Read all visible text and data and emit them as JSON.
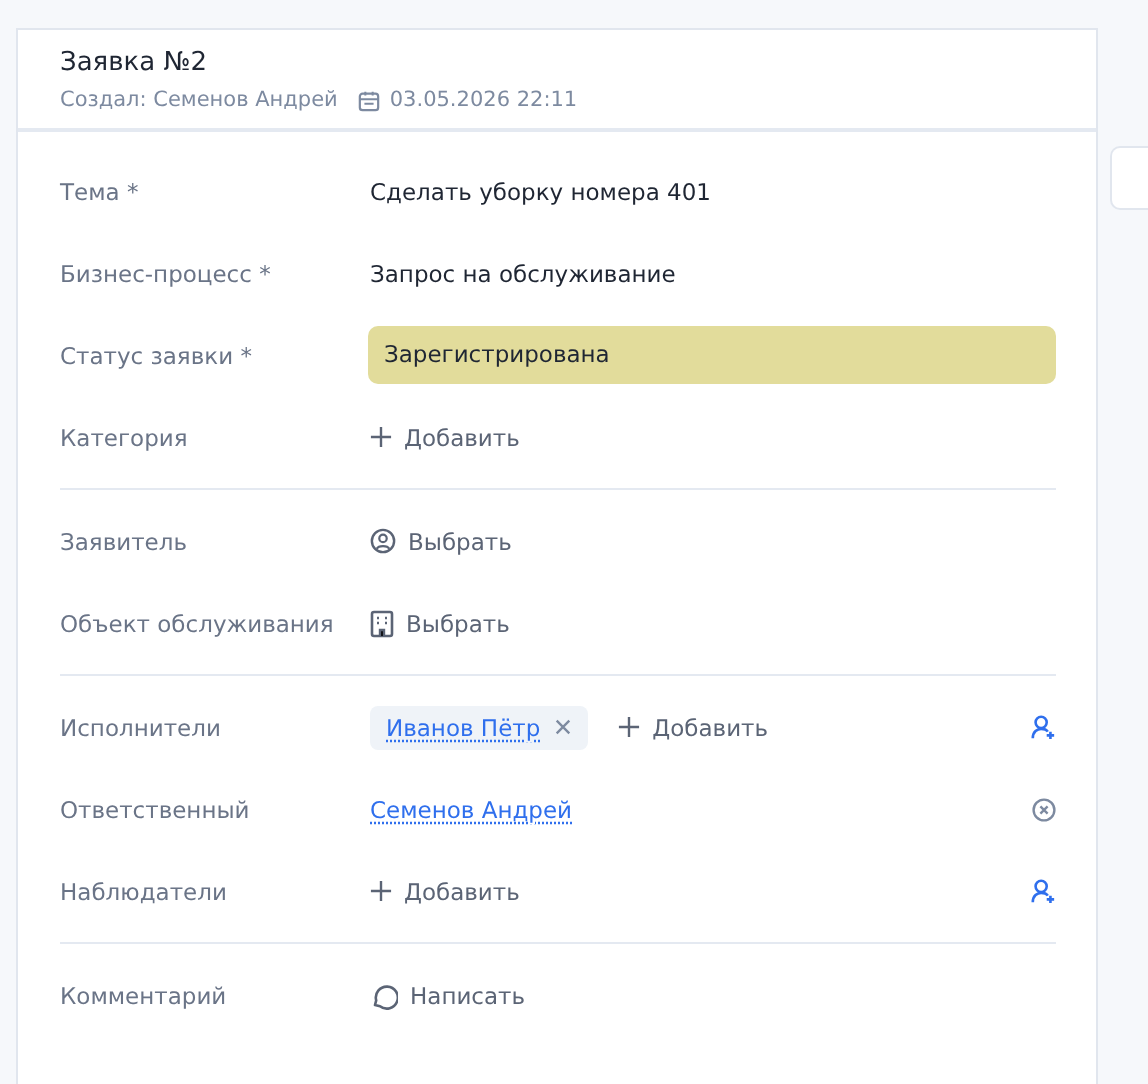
{
  "header": {
    "title": "Заявка №2",
    "author": "Создал: Семенов Андрей",
    "created": "03.05.2026 22:11"
  },
  "sections": [
    {
      "fields": [
        {
          "kind": "text",
          "label": "Тема *",
          "value": "Сделать уборку номера 401"
        },
        {
          "kind": "text",
          "label": "Бизнес-процесс *",
          "value": "Запрос на обслуживание"
        },
        {
          "kind": "status",
          "label": "Статус заявки *",
          "value": "Зарегистрирована",
          "color": "#e2dc9b"
        },
        {
          "kind": "add",
          "label": "Категория",
          "action": "Добавить",
          "assign": false
        }
      ]
    },
    {
      "fields": [
        {
          "kind": "person_pick",
          "label": "Заявитель",
          "action": "Выбрать"
        },
        {
          "kind": "object_pick",
          "label": "Объект обслуживания",
          "action": "Выбрать"
        }
      ]
    },
    {
      "fields": [
        {
          "kind": "people",
          "label": "Исполнители",
          "chips": [
            "Иванов Пётр"
          ],
          "action": "Добавить",
          "assign": true
        },
        {
          "kind": "link",
          "label": "Ответственный",
          "value": "Семенов Андрей",
          "clearable": true
        },
        {
          "kind": "add",
          "label": "Наблюдатели",
          "action": "Добавить",
          "assign": true
        }
      ]
    },
    {
      "fields": [
        {
          "kind": "comment",
          "label": "Комментарий",
          "action": "Написать"
        }
      ]
    }
  ]
}
